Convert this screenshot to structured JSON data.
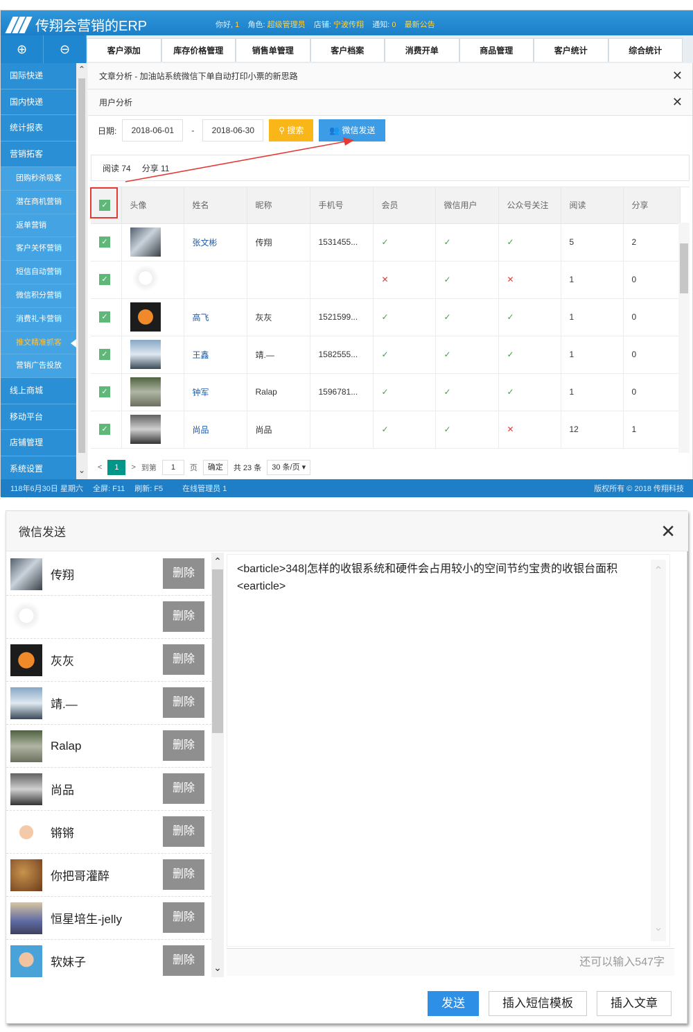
{
  "header": {
    "app_title": "传翔会营销的ERP",
    "greeting_label": "你好,",
    "greeting_value": "1",
    "role_label": "角色:",
    "role_value": "超级管理员",
    "store_label": "店铺:",
    "store_value": "宁波传翔",
    "notice_label": "通知:",
    "notice_value": "0",
    "announcement": "最新公告"
  },
  "controls": {
    "expand": "⊕",
    "collapse": "⊖"
  },
  "nav_tabs": [
    "客户添加",
    "库存价格管理",
    "销售单管理",
    "客户档案",
    "消费开单",
    "商品管理",
    "客户统计",
    "综合统计"
  ],
  "sidebar": [
    {
      "label": "国际快递",
      "sub": false
    },
    {
      "label": "国内快递",
      "sub": false
    },
    {
      "label": "统计报表",
      "sub": false
    },
    {
      "label": "营销拓客",
      "sub": false
    },
    {
      "label": "团购秒杀吸客",
      "sub": true
    },
    {
      "label": "潜在商机营销",
      "sub": true
    },
    {
      "label": "返单营销",
      "sub": true
    },
    {
      "label": "客户关怀营销",
      "sub": true
    },
    {
      "label": "短信自动营销",
      "sub": true
    },
    {
      "label": "微信积分营销",
      "sub": true
    },
    {
      "label": "消费礼卡营销",
      "sub": true
    },
    {
      "label": "推文精准抓客",
      "sub": true,
      "active": true
    },
    {
      "label": "营销广告投放",
      "sub": true
    },
    {
      "label": "线上商城",
      "sub": false
    },
    {
      "label": "移动平台",
      "sub": false
    },
    {
      "label": "店铺管理",
      "sub": false
    },
    {
      "label": "系统设置",
      "sub": false
    }
  ],
  "panel": {
    "article_tab": "文章分析 - 加油站系统微信下单自动打印小票的新思路",
    "user_tab": "用户分析"
  },
  "filter": {
    "date_label": "日期:",
    "start": "2018-06-01",
    "sep": "-",
    "end": "2018-06-30",
    "search": "搜索",
    "wechat_send": "微信发送"
  },
  "stats": {
    "read": "阅读 74",
    "share": "分享 11"
  },
  "table": {
    "headers": [
      "",
      "头像",
      "姓名",
      "昵称",
      "手机号",
      "会员",
      "微信用户",
      "公众号关注",
      "阅读",
      "分享"
    ],
    "rows": [
      {
        "name": "张文彬",
        "nick": "传翔",
        "phone": "1531455...",
        "member": true,
        "wx": true,
        "follow": true,
        "read": "5",
        "share": "2"
      },
      {
        "name": "",
        "nick": "",
        "phone": "",
        "member": false,
        "wx": true,
        "follow": false,
        "read": "1",
        "share": "0"
      },
      {
        "name": "高飞",
        "nick": "灰灰",
        "phone": "1521599...",
        "member": true,
        "wx": true,
        "follow": true,
        "read": "1",
        "share": "0"
      },
      {
        "name": "王鑫",
        "nick": "靖.—",
        "phone": "1582555...",
        "member": true,
        "wx": true,
        "follow": true,
        "read": "1",
        "share": "0"
      },
      {
        "name": "钟军",
        "nick": "Ralap",
        "phone": "1596781...",
        "member": true,
        "wx": true,
        "follow": true,
        "read": "1",
        "share": "0"
      },
      {
        "name": "尚品",
        "nick": "尚品",
        "phone": "",
        "member": true,
        "wx": true,
        "follow": false,
        "read": "12",
        "share": "1"
      }
    ]
  },
  "pager": {
    "page": "1",
    "goto": "到第",
    "page_input": "1",
    "page_unit": "页",
    "confirm": "确定",
    "total": "共 23 条",
    "per_page": "30 条/页"
  },
  "statusbar": {
    "date": "118年6月30日 星期六",
    "fullscreen": "全屏: F11",
    "refresh": "刷新: F5",
    "online": "在线管理员 1",
    "copyright": "版权所有 © 2018 传翔科技"
  },
  "dialog": {
    "title": "微信发送",
    "delete_label": "删除",
    "recipients": [
      "传翔",
      "",
      "灰灰",
      "靖.—",
      "Ralap",
      "尚品",
      "锵锵",
      "你把哥灌醉",
      "恒星培生-jelly",
      "软妹子"
    ],
    "message": "<barticle>348|怎样的收银系统和硬件会占用较小的空间节约宝贵的收银台面积<earticle>",
    "counter": "还可以输入547字",
    "send": "发送",
    "insert_sms": "插入短信模板",
    "insert_article": "插入文章"
  },
  "colors": {
    "brand_blue": "#1c7fc8",
    "search_yellow": "#f8b619",
    "check_green": "#5fb878",
    "ok_green": "#43a047",
    "no_red": "#e53935",
    "delete_gray": "#8f8f8f"
  }
}
